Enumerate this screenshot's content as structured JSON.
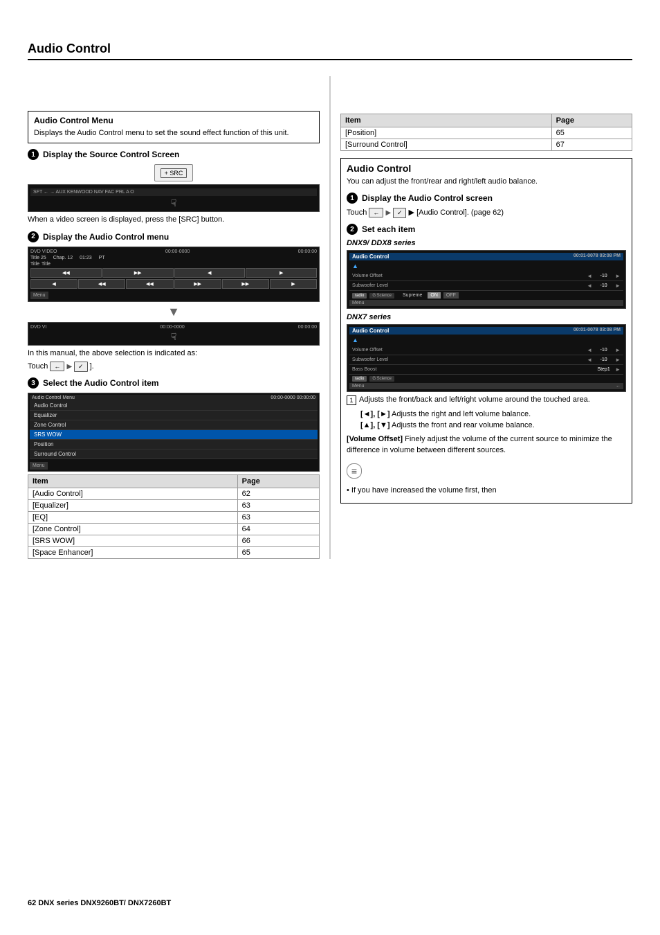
{
  "page": {
    "title": "Audio Control",
    "footer": "62    DNX series  DNX9260BT/ DNX7260BT"
  },
  "left_column": {
    "section_box": {
      "title": "Audio Control Menu",
      "description": "Displays the Audio Control menu to set the sound effect function of this unit."
    },
    "step1": {
      "label": "Display the Source Control Screen",
      "src_button": "+ SRC",
      "description": "When a video screen is displayed, press the [SRC] button."
    },
    "step2": {
      "label": "Display the Audio Control menu",
      "screen_title": "DVD VIDEO",
      "time1": "00:00-0000",
      "time2": "00:00:00",
      "title_label": "Title 25",
      "chap_label": "Chap. 12",
      "time_display": "01:23",
      "pt_label": "PT",
      "title_col": "Title",
      "title_col2": "Title",
      "controls": [
        "◀◀",
        "▶▶",
        "◀",
        "▶",
        "⏏"
      ],
      "controls2": [
        "◀",
        "◀◀",
        "◀◀",
        "▶▶",
        "▶▶",
        "▶"
      ],
      "menu_btn": "Menu",
      "arrow": "▼",
      "screen2_title": "DVD VI",
      "screen2_time": "00:00-0000",
      "screen2_time2": "00:00:00",
      "hand_symbol": "☟",
      "step2_desc1": "In this manual, the above selection is indicated as:",
      "step2_desc2": "Touch",
      "touch_seq": "[ ← ] ▶ [ ✓ ]"
    },
    "step3": {
      "label": "Select the Audio Control item",
      "screen_header": "Audio Control Menu",
      "screen_time": "00:00-0000",
      "screen_time2": "00:00:00",
      "menu_items": [
        "Audio Control",
        "Equalizer",
        "Zone Control",
        "SRS WOW",
        "Position",
        "Surround Control"
      ],
      "menu_btn": "Menu"
    },
    "table": {
      "headers": [
        "Item",
        "Page"
      ],
      "rows": [
        [
          "[Audio Control]",
          "62"
        ],
        [
          "[Equalizer]",
          "63"
        ],
        [
          "  [EQ]",
          "63"
        ],
        [
          "[Zone Control]",
          "64"
        ],
        [
          "[SRS WOW]",
          "66"
        ],
        [
          "[Space Enhancer]",
          "65"
        ]
      ]
    }
  },
  "right_column": {
    "table": {
      "rows": [
        [
          "[Position]",
          "65"
        ],
        [
          "[Surround Control]",
          "67"
        ]
      ]
    },
    "section": {
      "title": "Audio Control",
      "description": "You can adjust the front/rear and right/left audio balance."
    },
    "step1": {
      "label": "Display the Audio Control screen",
      "touch_desc": "Touch",
      "touch_seq": "[ ← ] ▶ [ ✓ ] ▶ [Audio Control]. (page 62)"
    },
    "step2": {
      "label": "Set each item",
      "dnx9_label": "DNX9/ DDX8 series",
      "dnx7_label": "DNX7 series",
      "screen": {
        "header": "Audio Control",
        "time": "00:01-0078",
        "time2": "03:08 PM",
        "volume_offset_label": "Volume Offset",
        "volume_offset_value": "-10",
        "subwoofer_label": "Subwoofer Level",
        "subwoofer_value": "-10",
        "tabs": [
          "radio",
          "G Science"
        ],
        "supreme_label": "Supreme",
        "on_label": "ON",
        "off_label": "OFF",
        "menu_btn": "Menu",
        "triangle": "▲"
      },
      "screen_dnx7": {
        "header": "Audio Control",
        "time": "00:01-0078",
        "time2": "03:08 PM",
        "volume_offset_label": "Volume Offset",
        "volume_offset_value": "-10",
        "subwoofer_label": "Subwoofer Level",
        "subwoofer_value": "-10",
        "bass_boost_label": "Bass Boost",
        "bass_boost_value": "Step1",
        "tabs": [
          "radio",
          "G Science"
        ],
        "menu_btn": "Menu",
        "triangle": "▲",
        "back_btn": "←"
      }
    },
    "descriptions": {
      "item1": "Adjusts the front/back and left/right volume around the touched area.",
      "item2_label": "[◄], [►]",
      "item2_desc": "Adjusts the right and left volume balance.",
      "item3_label": "[▲], [▼]",
      "item3_desc": "Adjusts the front and rear volume balance.",
      "volume_offset_label": "[Volume Offset]",
      "volume_offset_desc": "Finely adjust the volume of the current source to minimize the difference in volume between different sources.",
      "note_symbol": "≡",
      "bullet": "• If you have increased the volume first, then"
    }
  }
}
